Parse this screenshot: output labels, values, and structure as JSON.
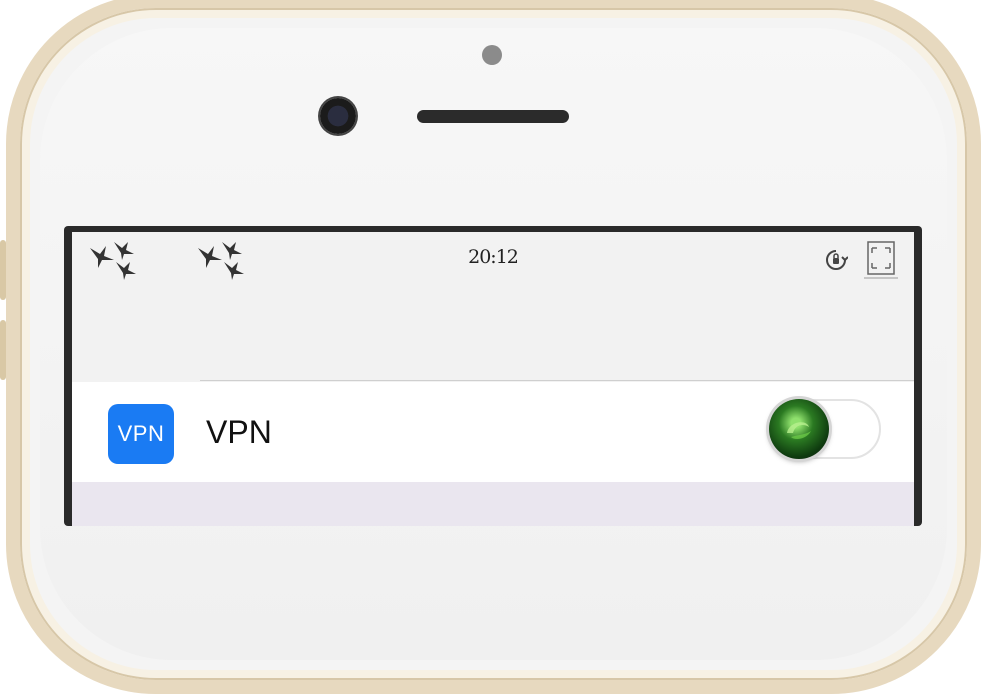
{
  "status_bar": {
    "time": "20:12",
    "left_icons": [
      "birds-icon",
      "birds-icon"
    ],
    "right_icons": [
      "rotation-lock-icon",
      "screenshot-icon"
    ]
  },
  "settings": {
    "vpn_row": {
      "app_icon_text": "VPN",
      "label": "VPN",
      "toggle_on": false
    }
  },
  "colors": {
    "vpn_icon_bg": "#1a7bf3",
    "phone_frame": "#e7d9bf",
    "toggle_knob": "#2b7a22"
  }
}
